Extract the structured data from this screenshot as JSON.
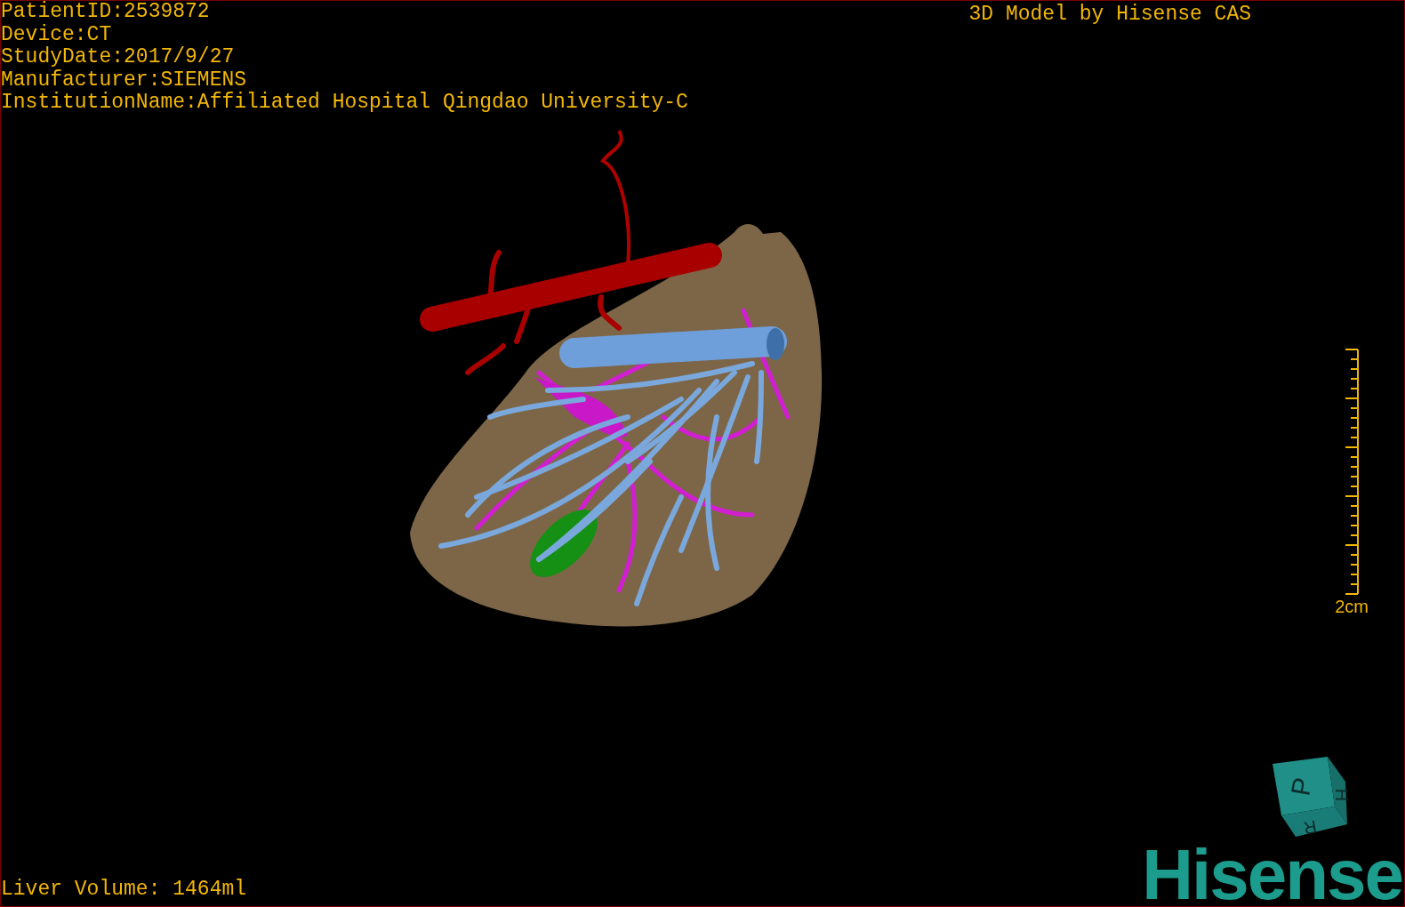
{
  "info_lines": [
    "PatientID:2539872",
    "Device:CT",
    "StudyDate:2017/9/27",
    "Manufacturer:SIEMENS",
    "InstitutionName:Affiliated Hospital Qingdao University-C"
  ],
  "title": "3D Model by Hisense CAS",
  "scale_bar": {
    "label": "2cm"
  },
  "status": "Liver Volume: 1464ml",
  "orientation_cube": {
    "faces": [
      "P",
      "H",
      "R"
    ]
  },
  "logo": "Hisense"
}
